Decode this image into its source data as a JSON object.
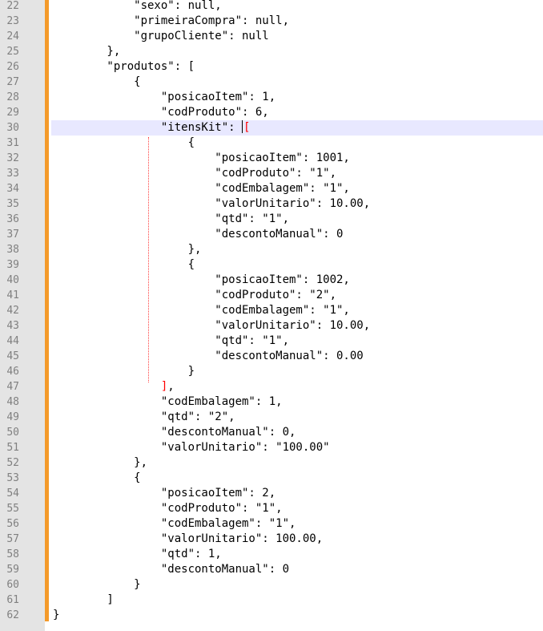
{
  "editor": {
    "current_line": "30",
    "lines": [
      {
        "n": "22",
        "text": "            \"sexo\": null,"
      },
      {
        "n": "23",
        "text": "            \"primeiraCompra\": null,"
      },
      {
        "n": "24",
        "text": "            \"grupoCliente\": null"
      },
      {
        "n": "25",
        "text": "        },"
      },
      {
        "n": "26",
        "text": "        \"produtos\": ["
      },
      {
        "n": "27",
        "text": "            {"
      },
      {
        "n": "28",
        "text": "                \"posicaoItem\": 1,"
      },
      {
        "n": "29",
        "text": "                \"codProduto\": 6,"
      },
      {
        "n": "30",
        "text": "                \"itensKit\": ",
        "bracket": "["
      },
      {
        "n": "31",
        "text": "                    {"
      },
      {
        "n": "32",
        "text": "                        \"posicaoItem\": 1001,"
      },
      {
        "n": "33",
        "text": "                        \"codProduto\": \"1\","
      },
      {
        "n": "34",
        "text": "                        \"codEmbalagem\": \"1\","
      },
      {
        "n": "35",
        "text": "                        \"valorUnitario\": 10.00,"
      },
      {
        "n": "36",
        "text": "                        \"qtd\": \"1\","
      },
      {
        "n": "37",
        "text": "                        \"descontoManual\": 0"
      },
      {
        "n": "38",
        "text": "                    },"
      },
      {
        "n": "39",
        "text": "                    {"
      },
      {
        "n": "40",
        "text": "                        \"posicaoItem\": 1002,"
      },
      {
        "n": "41",
        "text": "                        \"codProduto\": \"2\","
      },
      {
        "n": "42",
        "text": "                        \"codEmbalagem\": \"1\","
      },
      {
        "n": "43",
        "text": "                        \"valorUnitario\": 10.00,"
      },
      {
        "n": "44",
        "text": "                        \"qtd\": \"1\","
      },
      {
        "n": "45",
        "text": "                        \"descontoManual\": 0.00"
      },
      {
        "n": "46",
        "text": "                    }"
      },
      {
        "n": "47",
        "text": "                ",
        "bracket": "]",
        "after": ","
      },
      {
        "n": "48",
        "text": "                \"codEmbalagem\": 1,"
      },
      {
        "n": "49",
        "text": "                \"qtd\": \"2\","
      },
      {
        "n": "50",
        "text": "                \"descontoManual\": 0,"
      },
      {
        "n": "51",
        "text": "                \"valorUnitario\": \"100.00\""
      },
      {
        "n": "52",
        "text": "            },"
      },
      {
        "n": "53",
        "text": "            {"
      },
      {
        "n": "54",
        "text": "                \"posicaoItem\": 2,"
      },
      {
        "n": "55",
        "text": "                \"codProduto\": \"1\","
      },
      {
        "n": "56",
        "text": "                \"codEmbalagem\": \"1\","
      },
      {
        "n": "57",
        "text": "                \"valorUnitario\": 100.00,"
      },
      {
        "n": "58",
        "text": "                \"qtd\": 1,"
      },
      {
        "n": "59",
        "text": "                \"descontoManual\": 0"
      },
      {
        "n": "60",
        "text": "            }"
      },
      {
        "n": "61",
        "text": "        ]"
      },
      {
        "n": "62",
        "text": "}"
      }
    ]
  },
  "colors": {
    "gutter": "#e4e4e4",
    "change_bar": "#f49a2a",
    "current_line": "#e8e8ff",
    "bracket_match": "#ff0000"
  }
}
